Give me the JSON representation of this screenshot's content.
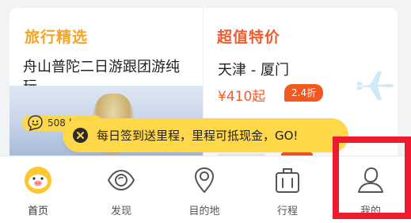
{
  "cards": {
    "left": {
      "title": "旅行精选",
      "tour_name": "舟山普陀二日游跟团游纯玩",
      "review_badge": "508人说好"
    },
    "right": {
      "title": "超值特价",
      "route": "天津 - 厦门",
      "price": "¥410起",
      "discount": "2.4折"
    }
  },
  "toast": {
    "text": "每日签到送里程，里程可抵现金，GO!"
  },
  "tabbar": {
    "items": [
      {
        "label": "首页",
        "icon": "pig-logo-icon",
        "active": true
      },
      {
        "label": "发现",
        "icon": "eye-icon",
        "active": false
      },
      {
        "label": "目的地",
        "icon": "location-pin-icon",
        "active": false
      },
      {
        "label": "行程",
        "icon": "suitcase-icon",
        "active": false
      },
      {
        "label": "我的",
        "icon": "person-icon",
        "active": false
      }
    ]
  },
  "colors": {
    "accent_orange": "#f5a524",
    "accent_red": "#f25b2b",
    "toast_yellow": "#ffd84a",
    "highlight_red": "#ee1b2f"
  }
}
